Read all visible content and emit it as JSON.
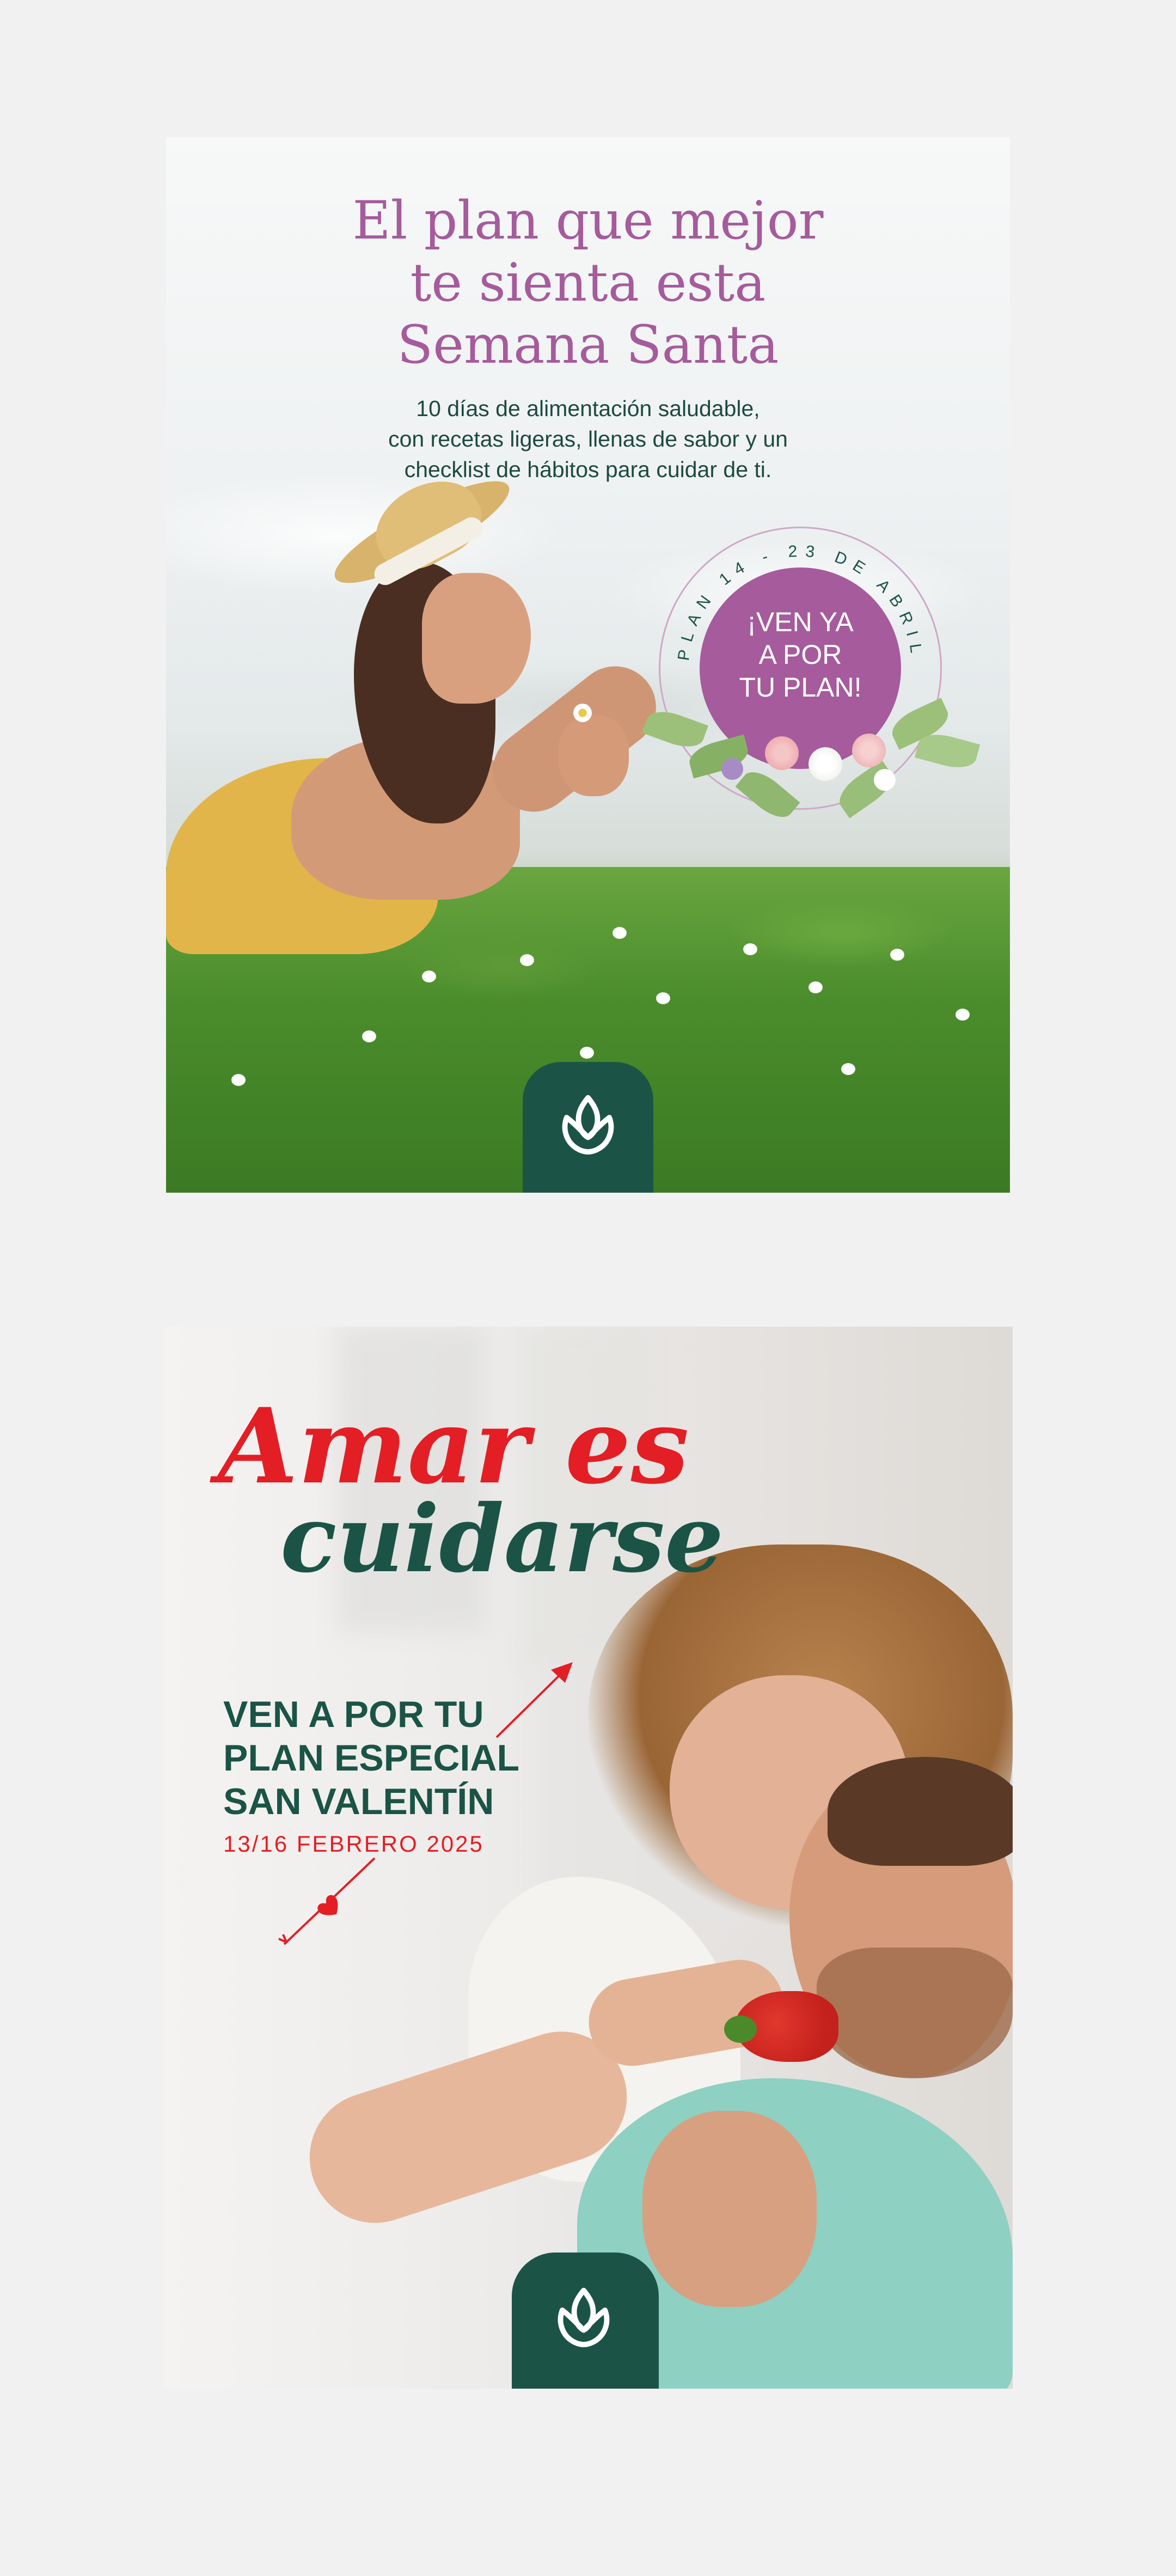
{
  "card1": {
    "title_lines": [
      "El plan que mejor",
      "te sienta esta",
      "Semana Santa"
    ],
    "subtitle_lines": [
      "10 días de alimentación saludable,",
      "con recetas ligeras, llenas de sabor y un",
      "checklist de hábitos para cuidar de ti."
    ],
    "badge": {
      "ring_text": "PLAN 14 - 23 DE ABRIL 2025",
      "lines": [
        "¡VEN YA",
        "A POR",
        "TU PLAN!"
      ]
    },
    "logo": "lotus-logo-icon"
  },
  "card2": {
    "headline_1": "Amar es",
    "headline_2": "cuidarse",
    "cta_lines": [
      "VEN A POR TU",
      "PLAN ESPECIAL",
      "SAN VALENTÍN"
    ],
    "date": "13/16 FEBRERO 2025",
    "logo": "lotus-logo-icon"
  },
  "colors": {
    "background": "#f1f1f1",
    "purple": "#a55b9c",
    "dark_green": "#1b5446",
    "red": "#e31e24"
  }
}
